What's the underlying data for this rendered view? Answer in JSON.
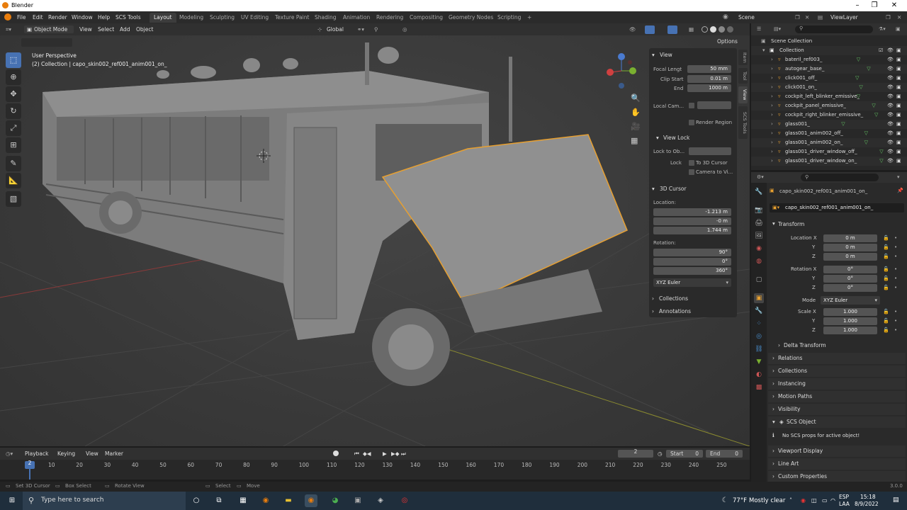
{
  "window": {
    "title": "Blender"
  },
  "menu": {
    "items": [
      "File",
      "Edit",
      "Render",
      "Window",
      "Help",
      "SCS Tools"
    ]
  },
  "workspaces": [
    "Layout",
    "Modeling",
    "Sculpting",
    "UV Editing",
    "Texture Paint",
    "Shading",
    "Animation",
    "Rendering",
    "Compositing",
    "Geometry Nodes",
    "Scripting"
  ],
  "workspaces_add": "+",
  "scene": {
    "name": "Scene",
    "view_layer": "ViewLayer"
  },
  "viewport": {
    "mode": "Object Mode",
    "menu": [
      "View",
      "Select",
      "Add",
      "Object"
    ],
    "orientation": "Global",
    "overlay_line1": "User Perspective",
    "overlay_line2": "(2) Collection | capo_skin002_ref001_anim001_on_",
    "options_label": "Options"
  },
  "npanel": {
    "view_title": "View",
    "focal_length_label": "Focal Lengt",
    "focal_length": "50 mm",
    "clip_start_label": "Clip Start",
    "clip_start": "0.01 m",
    "clip_end_label": "End",
    "clip_end": "1000 m",
    "local_camera_label": "Local Cam...",
    "render_region": "Render Region",
    "view_lock_title": "View Lock",
    "lock_to_object_label": "Lock to Ob...",
    "lock_label": "Lock",
    "to_3d_cursor": "To 3D Cursor",
    "camera_to_view": "Camera to Vi...",
    "cursor_title": "3D Cursor",
    "location_label": "Location:",
    "cursor_x_label": "X",
    "cursor_x": "-1.213 m",
    "cursor_y_label": "Y",
    "cursor_y": "-0 m",
    "cursor_z_label": "Z",
    "cursor_z": "1.744 m",
    "rotation_label": "Rotation:",
    "rot_x_label": "X",
    "rot_x": "90°",
    "rot_y_label": "Y",
    "rot_y": "0°",
    "rot_z_label": "Z",
    "rot_z": "360°",
    "rotation_mode": "XYZ Euler",
    "collections": "Collections",
    "annotations": "Annotations"
  },
  "side_tabs": [
    "Item",
    "Tool",
    "View",
    "SCS Tools"
  ],
  "outliner": {
    "root": "Scene Collection",
    "collection": "Collection",
    "items": [
      "bateril_ref003_",
      "autogear_base_",
      "click001_off_",
      "click001_on_",
      "cockpit_left_blinker_emissive_",
      "cockpit_panel_emissive_",
      "cockpit_right_blinker_emissive_",
      "glass001_",
      "glass001_anim002_off_",
      "glass001_anim002_on_",
      "glass001_driver_window_off_",
      "glass001_driver_window_on_"
    ]
  },
  "properties": {
    "object_name": "capo_skin002_ref001_anim001_on_",
    "object_field": "capo_skin002_ref001_anim001_on_",
    "transform_title": "Transform",
    "location_x_label": "Location X",
    "loc_x": "0 m",
    "y_label": "Y",
    "loc_y": "0 m",
    "z_label": "Z",
    "loc_z": "0 m",
    "rotation_x_label": "Rotation X",
    "rot_x": "0°",
    "rot_y": "0°",
    "rot_z": "0°",
    "mode_label": "Mode",
    "mode": "XYZ Euler",
    "scale_x_label": "Scale X",
    "scale_x": "1.000",
    "scale_y": "1.000",
    "scale_z": "1.000",
    "delta_transform": "Delta Transform",
    "sections": [
      "Relations",
      "Collections",
      "Instancing",
      "Motion Paths",
      "Visibility"
    ],
    "scs_object": "SCS Object",
    "scs_message": "No SCS props for active object!",
    "sections2": [
      "Viewport Display",
      "Line Art",
      "Custom Properties"
    ]
  },
  "timeline": {
    "menu": [
      "Playback",
      "Keying",
      "View",
      "Marker"
    ],
    "current_frame": "2",
    "start_label": "Start",
    "start": "0",
    "end_label": "End",
    "end": "0",
    "ticks": [
      "10",
      "20",
      "30",
      "40",
      "50",
      "60",
      "70",
      "80",
      "90",
      "100",
      "110",
      "120",
      "130",
      "140",
      "150",
      "160",
      "170",
      "180",
      "190",
      "200",
      "210",
      "220",
      "230",
      "240",
      "250"
    ],
    "playhead": "2"
  },
  "statusbar": {
    "items": [
      "Set 3D Cursor",
      "Box Select",
      "Rotate View",
      "Select",
      "Move"
    ],
    "version": "3.0.0"
  },
  "taskbar": {
    "search_placeholder": "Type here to search",
    "weather_temp": "77°F",
    "weather_text": "Mostly clear",
    "lang1": "ESP",
    "lang2": "LAA",
    "time": "15:18",
    "date": "8/9/2022"
  },
  "colors": {
    "accent": "#4772b3",
    "selection": "#e8a030",
    "brand": "#e87d0d"
  }
}
